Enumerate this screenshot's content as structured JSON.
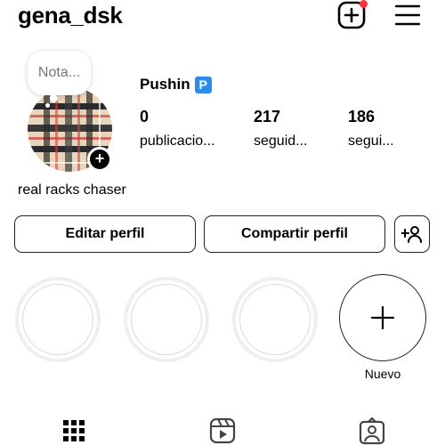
{
  "header": {
    "username": "gena_dsk"
  },
  "profile": {
    "note_placeholder": "Nota...",
    "display_name": "Pushin",
    "name_badge": "P",
    "bio": "real racks chaser",
    "avatar_badge_symbol": "+"
  },
  "stats": [
    {
      "value": "0",
      "label": "publicacio..."
    },
    {
      "value": "217",
      "label": "seguid..."
    },
    {
      "value": "186",
      "label": "segui..."
    }
  ],
  "buttons": {
    "edit_profile": "Editar perfil",
    "share_profile": "Compartir perfil"
  },
  "highlights": {
    "new_label": "Nuevo"
  },
  "icons": {
    "create": "plus-square-icon",
    "menu": "hamburger-menu-icon",
    "add_person": "add-person-icon",
    "grid": "grid-icon",
    "reels": "reels-icon",
    "tagged": "tagged-icon"
  },
  "colors": {
    "notification": "#ff3040",
    "badge_blue": "#2b8de8"
  }
}
